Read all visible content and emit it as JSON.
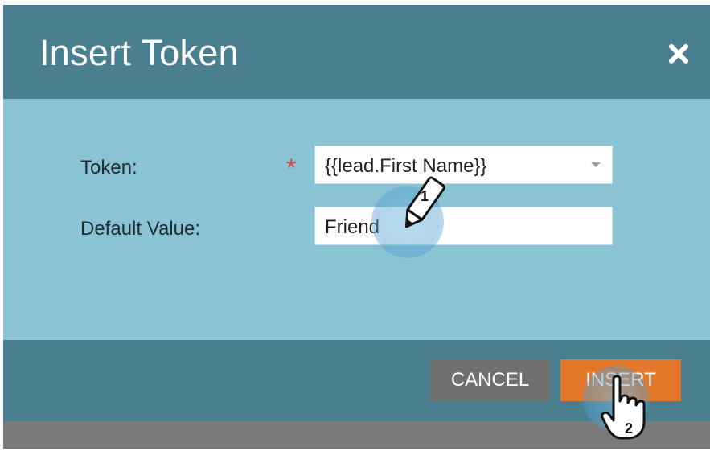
{
  "dialog": {
    "title": "Insert Token",
    "close_icon": "close-icon"
  },
  "form": {
    "token_label": "Token:",
    "required_mark": "*",
    "token_value": "{{lead.First Name}}",
    "default_label": "Default Value:",
    "default_value": "Friend"
  },
  "footer": {
    "cancel_label": "CANCEL",
    "insert_label": "INSERT"
  },
  "annotations": {
    "step1_label": "1",
    "step2_label": "2"
  },
  "colors": {
    "header": "#4a7f90",
    "body": "#8ac3d4",
    "cancel": "#6f6f6f",
    "insert": "#e3782b",
    "required": "#d14a45"
  }
}
